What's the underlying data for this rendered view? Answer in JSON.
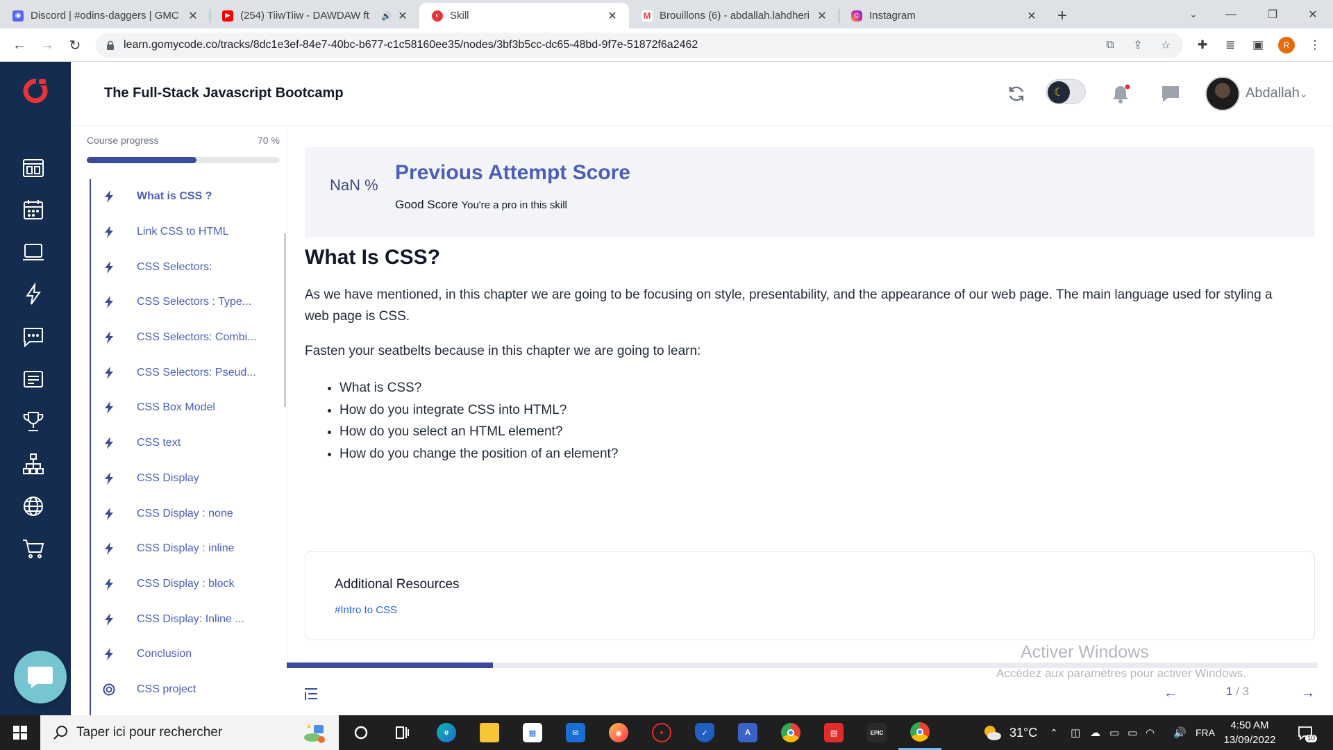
{
  "browser": {
    "tabs": [
      {
        "title": "Discord | #odins-daggers | GMC",
        "favicon": "discord-icon",
        "color": "#5865f2"
      },
      {
        "title": "(254) TiiwTiiw - DAWDAW ft",
        "favicon": "youtube-icon",
        "color": "#ff0000",
        "audio": true
      },
      {
        "title": "Skill",
        "favicon": "gomycode-icon",
        "color": "#e8333a",
        "active": true
      },
      {
        "title": "Brouillons (6) - abdallah.lahdheri",
        "favicon": "gmail-icon",
        "color": "#ea4335"
      },
      {
        "title": "Instagram",
        "favicon": "instagram-icon",
        "color": "#d6249f"
      }
    ],
    "url": "learn.gomycode.co/tracks/8dc1e3ef-84e7-40bc-b677-c1c58160ee35/nodes/3bf3b5cc-dc65-48bd-9f7e-51872f6a2462",
    "profile_initial": "R"
  },
  "header": {
    "course_title": "The Full-Stack Javascript Bootcamp",
    "user_name": "Abdallah",
    "brand_color": "#142c4f",
    "accent_color": "#4b5fb8"
  },
  "progress": {
    "label": "Course progress",
    "percent_text": "70 %",
    "value": 0.57
  },
  "lessons": [
    {
      "label": "What is CSS ?",
      "active": true,
      "icon": "bolt-icon"
    },
    {
      "label": "Link CSS to HTML",
      "icon": "bolt-icon"
    },
    {
      "label": "CSS Selectors:",
      "icon": "bolt-icon"
    },
    {
      "label": "CSS Selectors : Type...",
      "icon": "bolt-icon"
    },
    {
      "label": "CSS Selectors: Combi...",
      "icon": "bolt-icon"
    },
    {
      "label": "CSS Selectors: Pseud...",
      "icon": "bolt-icon"
    },
    {
      "label": "CSS Box Model",
      "icon": "bolt-icon"
    },
    {
      "label": "CSS text",
      "icon": "bolt-icon"
    },
    {
      "label": "CSS Display",
      "icon": "bolt-icon"
    },
    {
      "label": "CSS Display : none",
      "icon": "bolt-icon"
    },
    {
      "label": "CSS Display : inline",
      "icon": "bolt-icon"
    },
    {
      "label": "CSS Display : block",
      "icon": "bolt-icon"
    },
    {
      "label": "CSS Display: Inline ...",
      "icon": "bolt-icon"
    },
    {
      "label": "Conclusion",
      "icon": "bolt-icon"
    },
    {
      "label": "CSS project",
      "icon": "target-icon"
    }
  ],
  "score": {
    "percent": "NaN %",
    "title": "Previous Attempt Score",
    "rating": "Good Score",
    "message": "You're a pro in this skill"
  },
  "content": {
    "heading": "What Is CSS?",
    "paragraph1": "As we have mentioned, in this chapter we are going to be focusing on style, presentability, and the appearance of our web page. The main language used for styling a web page is CSS.",
    "paragraph2": "Fasten your seatbelts because in this chapter we are going to learn:",
    "bullets": [
      "What is CSS?",
      "How do you integrate CSS into HTML?",
      "How do you select an HTML element?",
      "How do you change the position of an element?"
    ]
  },
  "resources": {
    "title": "Additional Resources",
    "link": "#Intro to CSS"
  },
  "pager": {
    "current": "1",
    "total": "/ 3",
    "progress": 0.2
  },
  "watermark": {
    "line1": "Activer Windows",
    "line2": "Accédez aux paramètres pour activer Windows."
  },
  "taskbar": {
    "search_placeholder": "Taper ici pour rechercher",
    "temperature": "31°C",
    "language": "FRA",
    "time": "4:50 AM",
    "date": "13/09/2022",
    "notifications": "10"
  }
}
